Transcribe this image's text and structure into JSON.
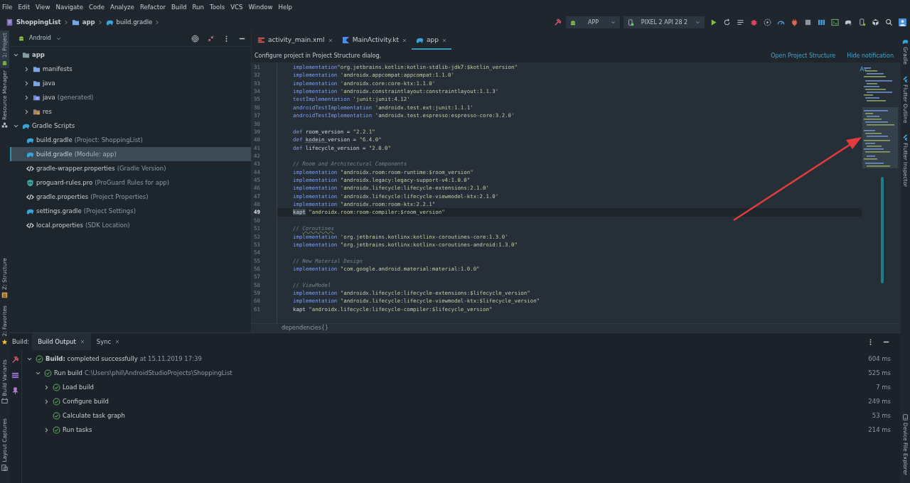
{
  "menu_bar": [
    "File",
    "Edit",
    "View",
    "Navigate",
    "Code",
    "Analyze",
    "Refactor",
    "Build",
    "Run",
    "Tools",
    "VCS",
    "Window",
    "Help"
  ],
  "breadcrumbs": [
    "ShoppingList",
    "app",
    "build.gradle"
  ],
  "toolbar": {
    "run_configuration": "APP",
    "device": "PIXEL 2 API 28 2"
  },
  "left_tool_strip": {
    "top": [
      {
        "label": "1: Project",
        "kind": "android",
        "selected": true
      },
      {
        "label": "Resource Manager",
        "kind": "resources",
        "selected": false
      }
    ],
    "middle": [
      {
        "label": "Z: Structure",
        "kind": "structure",
        "selected": false
      }
    ],
    "bottom": [
      {
        "label": "2: Favorites",
        "kind": "star",
        "selected": false
      },
      {
        "label": "Build Variants",
        "kind": "variants",
        "selected": false
      },
      {
        "label": "Layout Captures",
        "kind": "layout",
        "selected": false
      }
    ]
  },
  "right_tool_strip": {
    "top": [
      {
        "label": "Gradle",
        "kind": "gradle",
        "selected": false
      },
      {
        "label": "Flutter Outline",
        "kind": "flutter",
        "selected": false
      },
      {
        "label": "Flutter Inspector",
        "kind": "flutter",
        "selected": false
      }
    ],
    "bottom": [
      {
        "label": "Device File Explorer",
        "kind": "device",
        "selected": false
      }
    ]
  },
  "project_panel": {
    "view": "Android",
    "tree": [
      {
        "label": "app",
        "kind": "module",
        "expanded": true,
        "selected": false,
        "children": [
          {
            "label": "manifests",
            "kind": "folder",
            "expanded": false,
            "selected": false
          },
          {
            "label": "java",
            "kind": "folder",
            "expanded": false,
            "selected": false
          },
          {
            "label": "java",
            "hint": "(generated)",
            "kind": "generated",
            "expanded": false,
            "selected": false
          },
          {
            "label": "res",
            "kind": "res",
            "expanded": false,
            "selected": false
          }
        ]
      },
      {
        "label": "Gradle Scripts",
        "kind": "gradle",
        "expanded": true,
        "selected": false,
        "children": [
          {
            "label": "build.gradle",
            "hint": "(Project: ShoppingList)",
            "kind": "gradle",
            "selected": false
          },
          {
            "label": "build.gradle",
            "hint": "(Module: app)",
            "kind": "gradle",
            "selected": true
          },
          {
            "label": "gradle-wrapper.properties",
            "hint": "(Gradle Version)",
            "kind": "properties",
            "selected": false
          },
          {
            "label": "proguard-rules.pro",
            "hint": "(ProGuard Rules for app)",
            "kind": "proguard",
            "selected": false
          },
          {
            "label": "gradle.properties",
            "hint": "(Project Properties)",
            "kind": "properties",
            "selected": false
          },
          {
            "label": "settings.gradle",
            "hint": "(Project Settings)",
            "kind": "gradle",
            "selected": false
          },
          {
            "label": "local.properties",
            "hint": "(SDK Location)",
            "kind": "properties",
            "selected": false
          }
        ]
      }
    ]
  },
  "editor_tabs": [
    {
      "label": "activity_main.xml",
      "kind": "xml",
      "selected": false
    },
    {
      "label": "MainActivity.kt",
      "kind": "kotlin",
      "selected": false
    },
    {
      "label": "app",
      "kind": "gradle",
      "selected": true
    }
  ],
  "notification": {
    "message": "Configure project in Project Structure dialog.",
    "actions": [
      "Open Project Structure",
      "Hide notification"
    ]
  },
  "code_lines": [
    {
      "number": "31",
      "current": false,
      "segments": [
        {
          "kind": "keyword",
          "text": "implementation"
        },
        {
          "kind": "string",
          "text": "\"org.jetbrains.kotlin:kotlin-stdlib-jdk7:$kotlin_version\""
        }
      ]
    },
    {
      "number": "32",
      "current": false,
      "segments": [
        {
          "kind": "keyword",
          "text": "implementation"
        },
        {
          "kind": "string",
          "text": " 'androidx.appcompat:appcompat:1.1.0'"
        }
      ]
    },
    {
      "number": "33",
      "current": false,
      "segments": [
        {
          "kind": "keyword",
          "text": "implementation"
        },
        {
          "kind": "string",
          "text": " 'androidx.core:core-ktx:1.1.0'"
        }
      ]
    },
    {
      "number": "34",
      "current": false,
      "segments": [
        {
          "kind": "keyword",
          "text": "implementation"
        },
        {
          "kind": "string",
          "text": " 'androidx.constraintlayout:constraintlayout:1.1.3'"
        }
      ]
    },
    {
      "number": "35",
      "current": false,
      "segments": [
        {
          "kind": "keyword",
          "text": "testImplementation"
        },
        {
          "kind": "string",
          "text": " 'junit:junit:4.12'"
        }
      ]
    },
    {
      "number": "36",
      "current": false,
      "segments": [
        {
          "kind": "keyword",
          "text": "androidTestImplementation"
        },
        {
          "kind": "string",
          "text": " 'androidx.test.ext:junit:1.1.1'"
        }
      ]
    },
    {
      "number": "37",
      "current": false,
      "segments": [
        {
          "kind": "keyword",
          "text": "androidTestImplementation"
        },
        {
          "kind": "string",
          "text": " 'androidx.test.espresso:espresso-core:3.2.0'"
        }
      ]
    },
    {
      "number": "38",
      "current": false
    },
    {
      "number": "39",
      "current": false,
      "segments": [
        {
          "kind": "keyword",
          "text": "def"
        },
        {
          "kind": "plain",
          "text": " room_version = "
        },
        {
          "kind": "string",
          "text": "\"2.2.1\""
        }
      ]
    },
    {
      "number": "40",
      "current": false,
      "segments": [
        {
          "kind": "keyword",
          "text": "def "
        },
        {
          "kind": "typo",
          "text": "kodein"
        },
        {
          "kind": "plain",
          "text": "_version = "
        },
        {
          "kind": "string",
          "text": "\"6.4.0\""
        }
      ]
    },
    {
      "number": "41",
      "current": false,
      "segments": [
        {
          "kind": "keyword",
          "text": "def"
        },
        {
          "kind": "plain",
          "text": " lifecycle_version = "
        },
        {
          "kind": "string",
          "text": "\"2.0.0\""
        }
      ]
    },
    {
      "number": "42",
      "current": false
    },
    {
      "number": "43",
      "current": false,
      "segments": [
        {
          "kind": "comment",
          "text": "// Room and Architectural Components"
        }
      ]
    },
    {
      "number": "44",
      "current": false,
      "segments": [
        {
          "kind": "keyword",
          "text": "implementation"
        },
        {
          "kind": "string",
          "text": " \"androidx.room:room-runtime:$room_version\""
        }
      ]
    },
    {
      "number": "45",
      "current": false,
      "segments": [
        {
          "kind": "keyword",
          "text": "implementation"
        },
        {
          "kind": "string",
          "text": " \"androidx.legacy:legacy-support-v4:1.0.0\""
        }
      ]
    },
    {
      "number": "46",
      "current": false,
      "segments": [
        {
          "kind": "keyword",
          "text": "implementation"
        },
        {
          "kind": "string",
          "text": " 'androidx.lifecycle:lifecycle-extensions:2.1.0'"
        }
      ]
    },
    {
      "number": "47",
      "current": false,
      "segments": [
        {
          "kind": "keyword",
          "text": "implementation"
        },
        {
          "kind": "string",
          "text": " 'androidx.lifecycle:lifecycle-viewmodel-ktx:2.1.0'"
        }
      ]
    },
    {
      "number": "48",
      "current": false,
      "segments": [
        {
          "kind": "keyword",
          "text": "implementation"
        },
        {
          "kind": "string",
          "text": " \"androidx.room:room-ktx:2.2.1\""
        }
      ]
    },
    {
      "number": "49",
      "current": true,
      "segments": [
        {
          "kind": "usage",
          "text": "kapt"
        },
        {
          "kind": "string",
          "text": " \"androidx.room:room-compiler:$room_version\""
        }
      ]
    },
    {
      "number": "50",
      "current": false
    },
    {
      "number": "51",
      "current": false,
      "segments": [
        {
          "kind": "comment",
          "text": "// "
        },
        {
          "kind": "comment_typo",
          "text": "Coroutines"
        }
      ]
    },
    {
      "number": "52",
      "current": false,
      "segments": [
        {
          "kind": "keyword",
          "text": "implementation"
        },
        {
          "kind": "string",
          "text": " 'org.jetbrains.kotlinx:kotlinx-coroutines-core:1.3.0'"
        }
      ]
    },
    {
      "number": "53",
      "current": false,
      "segments": [
        {
          "kind": "keyword",
          "text": "implementation"
        },
        {
          "kind": "string",
          "text": " \"org.jetbrains.kotlinx:kotlinx-coroutines-android:1.3.0\""
        }
      ]
    },
    {
      "number": "54",
      "current": false
    },
    {
      "number": "55",
      "current": false,
      "segments": [
        {
          "kind": "comment",
          "text": "// New Material Design"
        }
      ]
    },
    {
      "number": "56",
      "current": false,
      "segments": [
        {
          "kind": "keyword",
          "text": "implementation"
        },
        {
          "kind": "string",
          "text": " \"com.google.android.material:material:1.0.0\""
        }
      ]
    },
    {
      "number": "57",
      "current": false
    },
    {
      "number": "58",
      "current": false,
      "segments": [
        {
          "kind": "comment",
          "text": "// ViewModel"
        }
      ]
    },
    {
      "number": "59",
      "current": false,
      "segments": [
        {
          "kind": "keyword",
          "text": "implementation"
        },
        {
          "kind": "string",
          "text": " \"androidx.lifecycle:lifecycle-extensions:$lifecycle_version\""
        }
      ]
    },
    {
      "number": "60",
      "current": false,
      "segments": [
        {
          "kind": "keyword",
          "text": "implementation"
        },
        {
          "kind": "string",
          "text": " \"androidx.lifecycle:lifecycle-viewmodel-ktx:$lifecycle_version\""
        }
      ]
    },
    {
      "number": "61",
      "current": false,
      "segments": [
        {
          "kind": "plain",
          "text": "kapt"
        },
        {
          "kind": "string",
          "text": " \"androidx.lifecycle:lifecycle-compiler:$lifecycle_version\""
        }
      ]
    }
  ],
  "editor_breadcrumb": "dependencies{}",
  "build_panel": {
    "title": "Build:",
    "tabs": [
      {
        "label": "Build Output",
        "selected": true
      },
      {
        "label": "Sync",
        "selected": false
      }
    ],
    "tree": [
      {
        "label": "**Build:** completed successfully",
        "hint": "at 15.11.2019 17:39",
        "duration": "604 ms",
        "expanded": true,
        "children": [
          {
            "label": "Run build",
            "hint": "C:\\Users\\phil\\AndroidStudioProjects\\ShoppingList",
            "duration": "525 ms",
            "expanded": true,
            "children": [
              {
                "label": "Load build",
                "duration": "7 ms",
                "expanded": false
              },
              {
                "label": "Configure build",
                "duration": "249 ms",
                "expanded": false
              },
              {
                "label": "Calculate task graph",
                "duration": "53 ms"
              },
              {
                "label": "Run tasks",
                "duration": "214 ms",
                "expanded": false
              }
            ]
          }
        ]
      }
    ]
  }
}
